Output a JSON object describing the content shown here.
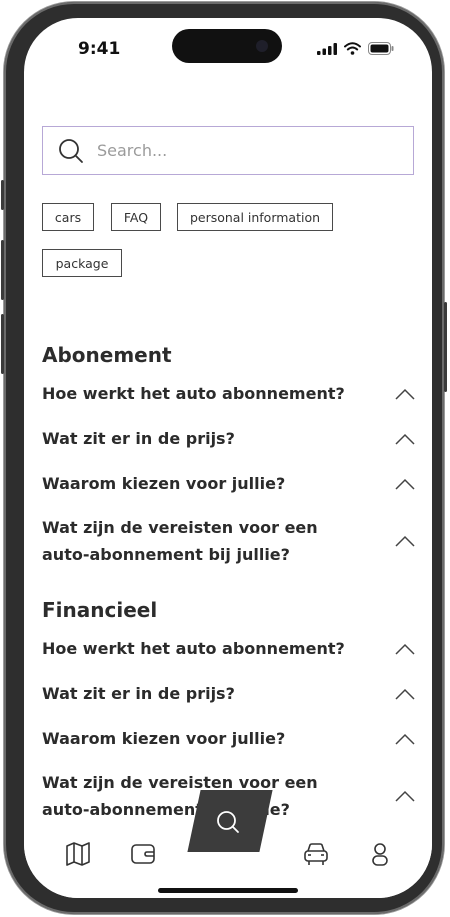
{
  "status": {
    "time": "9:41"
  },
  "search": {
    "placeholder": "Search..."
  },
  "tags": [
    "cars",
    "FAQ",
    "personal information",
    "package"
  ],
  "sections": [
    {
      "title": "Abonement",
      "questions": [
        "Hoe werkt het auto abonnement?",
        "Wat zit er in de prijs?",
        "Waarom kiezen voor jullie?",
        "Wat zijn de vereisten voor een auto-abonnement bij jullie?"
      ]
    },
    {
      "title": "Financieel",
      "questions": [
        "Hoe werkt het auto abonnement?",
        "Wat zit er in de prijs?",
        "Waarom kiezen voor jullie?",
        "Wat zijn de vereisten voor een auto-abonnement bij jullie?"
      ]
    }
  ],
  "nav": {
    "items": [
      "map-icon",
      "wallet-icon",
      "search-icon",
      "car-icon",
      "user-icon"
    ],
    "active": "search-icon"
  },
  "colors": {
    "search_border": "#b7a8d6",
    "nav_active_bg": "#3c3c3c",
    "text": "#2b2b2b"
  }
}
